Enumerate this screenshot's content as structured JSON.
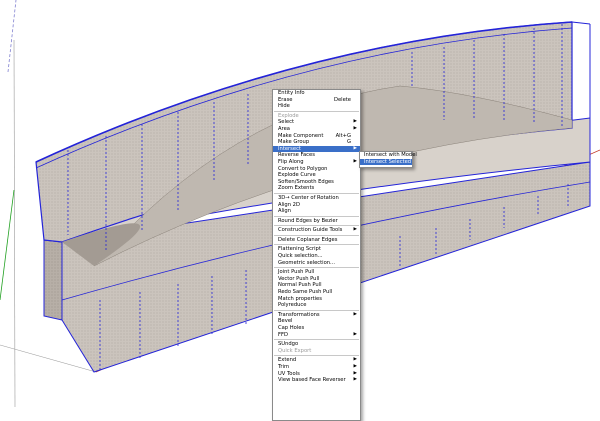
{
  "context_menu": {
    "groups": [
      [
        {
          "label": "Entity Info"
        },
        {
          "label": "Erase",
          "shortcut": "Delete"
        },
        {
          "label": "Hide"
        }
      ],
      [
        {
          "label": "Explode",
          "disabled": true
        },
        {
          "label": "Select",
          "submenu": true
        },
        {
          "label": "Area",
          "submenu": true
        },
        {
          "label": "Make Component",
          "shortcut": "Alt+G"
        },
        {
          "label": "Make Group",
          "shortcut": "G"
        },
        {
          "label": "Intersect",
          "submenu": true,
          "highlighted": true
        },
        {
          "label": "Reverse Faces"
        },
        {
          "label": "Flip Along",
          "submenu": true
        },
        {
          "label": "Convert to Polygon"
        },
        {
          "label": "Explode Curve"
        },
        {
          "label": "Soften/Smooth Edges"
        },
        {
          "label": "Zoom Extents"
        }
      ],
      [
        {
          "label": "3D→ Center of Rotation"
        },
        {
          "label": "Align 2D"
        },
        {
          "label": "Align"
        }
      ],
      [
        {
          "label": "Round Edges by Bezier"
        }
      ],
      [
        {
          "label": "Construction Guide Tools",
          "submenu": true
        }
      ],
      [
        {
          "label": "Delete Coplanar Edges"
        }
      ],
      [
        {
          "label": "Flattening Script"
        },
        {
          "label": "Quick selection..."
        },
        {
          "label": "Geometric selection..."
        }
      ],
      [
        {
          "label": "Joint Push Pull"
        },
        {
          "label": "Vector Push Pull"
        },
        {
          "label": "Normal Push Pull"
        },
        {
          "label": "Redo Same Push Pull"
        },
        {
          "label": "Match properties"
        },
        {
          "label": "Polyreduce"
        }
      ],
      [
        {
          "label": "Transformations",
          "submenu": true
        },
        {
          "label": "Bevel"
        },
        {
          "label": "Cap Holes"
        },
        {
          "label": "FFD",
          "submenu": true
        }
      ],
      [
        {
          "label": "SUndgo"
        },
        {
          "label": "Quick Export",
          "disabled": true
        }
      ],
      [
        {
          "label": "Extend",
          "submenu": true
        },
        {
          "label": "Trim",
          "submenu": true
        },
        {
          "label": "UV Tools",
          "submenu": true
        },
        {
          "label": "View based Face Reverser",
          "submenu": true
        }
      ]
    ]
  },
  "intersect_submenu": {
    "items": [
      {
        "label": "Intersect with Model"
      },
      {
        "label": "Intersect Selected",
        "highlighted": true
      }
    ]
  },
  "colors": {
    "face_fill": "#c9c2bb",
    "face_fill_dark": "#b0a8a0",
    "selection_edge": "#2424d8",
    "menu_highlight": "#3a6fc8",
    "axis_red": "#c03020",
    "axis_green": "#20a020"
  }
}
